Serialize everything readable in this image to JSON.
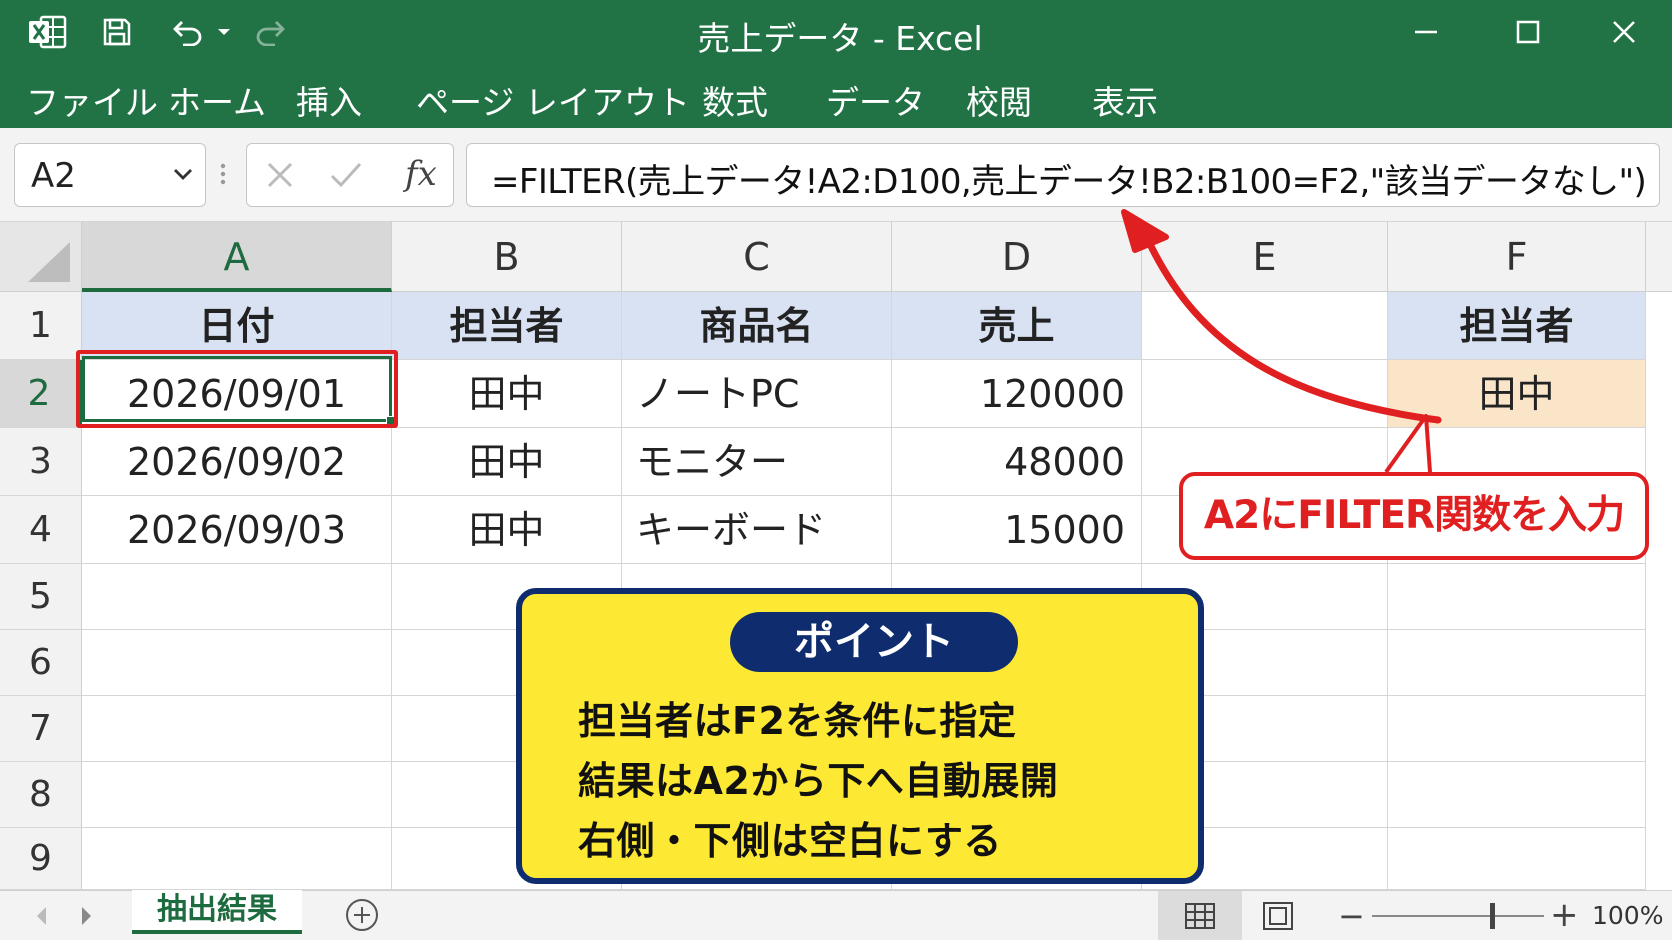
{
  "window": {
    "title": "売上データ  -  Excel",
    "icons": [
      "excel-logo-icon",
      "save-icon",
      "undo-icon",
      "redo-icon",
      "minimize-icon",
      "maximize-icon",
      "close-icon"
    ]
  },
  "ribbon": {
    "tabs": [
      "ファイル",
      "ホーム",
      "挿入",
      "ページ レイアウト",
      "数式",
      "データ",
      "校閲",
      "表示"
    ]
  },
  "formula_bar": {
    "name_box": "A2",
    "fx": "fx",
    "formula": "=FILTER(売上データ!A2:D100,売上データ!B2:B100=F2,\"該当データなし\")"
  },
  "grid": {
    "columns": [
      "A",
      "B",
      "C",
      "D",
      "E",
      "F"
    ],
    "rows": [
      "1",
      "2",
      "3",
      "4",
      "5",
      "6",
      "7",
      "8",
      "9"
    ],
    "headers": {
      "A": "日付",
      "B": "担当者",
      "C": "商品名",
      "D": "売上",
      "F": "担当者"
    },
    "data": [
      {
        "date": "2026/09/01",
        "person": "田中",
        "product": "ノートPC",
        "sales": "120000"
      },
      {
        "date": "2026/09/02",
        "person": "田中",
        "product": "モニター",
        "sales": "48000"
      },
      {
        "date": "2026/09/03",
        "person": "田中",
        "product": "キーボード",
        "sales": "15000"
      }
    ],
    "condition_value": "田中",
    "active_cell": "A2"
  },
  "annotations": {
    "callout": "A2にFILTER関数を入力",
    "point_title": "ポイント",
    "point_lines": [
      "担当者はF2を条件に指定",
      "結果はA2から下へ自動展開",
      "右側・下側は空白にする"
    ],
    "colors": {
      "excel_green": "#217346",
      "callout_red": "#e02020",
      "point_yellow": "#fde933",
      "point_navy": "#0f2d6e",
      "header_blue": "#d9e2f3",
      "condition_orange": "#fbe5c8"
    }
  },
  "status_bar": {
    "sheet_tab": "抽出結果",
    "zoom_minus": "−",
    "zoom_plus": "+",
    "zoom": "100%",
    "zoom_fraction": 0.7
  }
}
